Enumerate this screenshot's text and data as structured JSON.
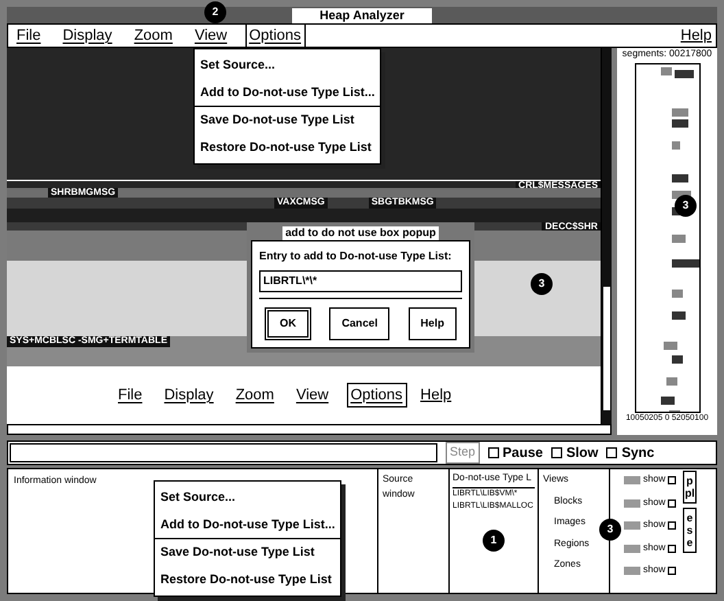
{
  "window": {
    "title": "Heap Analyzer",
    "callout": "2"
  },
  "menu_bar": {
    "items": [
      {
        "label": "File",
        "selected": false
      },
      {
        "label": "Display",
        "selected": false
      },
      {
        "label": "Zoom",
        "selected": false
      },
      {
        "label": "View",
        "selected": false
      },
      {
        "label": "Options",
        "selected": true
      }
    ],
    "help": "Help"
  },
  "options_menu": {
    "items": [
      {
        "label": "Set Source...",
        "separator_before": false
      },
      {
        "label": "Add to Do-not-use Type List...",
        "separator_before": false
      },
      {
        "label": "Save Do-not-use Type List",
        "separator_before": true
      },
      {
        "label": "Restore Do-not-use Type List",
        "separator_before": false
      }
    ]
  },
  "canvas": {
    "labels": [
      "CRL$MESSAGES",
      "SHRBMGMSG",
      "VAXCMSG",
      "SBGTBKMSG",
      "DECC$SHR",
      "SYS+MCBLSC -SMG+TERMTABLE"
    ],
    "callout": "3"
  },
  "dialog": {
    "title": "add to do not use box popup",
    "prompt": "Entry to add to Do-not-use Type List:",
    "value": "LIBRTL\\*\\*",
    "buttons": [
      {
        "label": "OK",
        "default": true
      },
      {
        "label": "Cancel",
        "default": false
      },
      {
        "label": "Help",
        "default": false
      }
    ]
  },
  "canvas_menu": {
    "items": [
      {
        "label": "File",
        "selected": false
      },
      {
        "label": "Display",
        "selected": false
      },
      {
        "label": "Zoom",
        "selected": false
      },
      {
        "label": "View",
        "selected": false
      },
      {
        "label": "Options",
        "selected": true
      }
    ],
    "help": "Help"
  },
  "segments": {
    "title": "segments: 00217800",
    "axis": "10050205 0 52050100",
    "callout": "3"
  },
  "controls": {
    "step": {
      "label": "Step",
      "disabled": true
    },
    "checkboxes": [
      {
        "label": "Pause",
        "checked": false
      },
      {
        "label": "Slow",
        "checked": false
      },
      {
        "label": "Sync",
        "checked": false
      }
    ]
  },
  "info_window": {
    "title": "Information window",
    "menu": [
      {
        "label": "Set Source...",
        "separator_before": false
      },
      {
        "label": "Add to Do-not-use Type List...",
        "separator_before": false
      },
      {
        "label": "Save Do-not-use Type List",
        "separator_before": true
      },
      {
        "label": "Restore Do-not-use Type List",
        "separator_before": false
      }
    ]
  },
  "source_window": {
    "title": "Source window"
  },
  "type_list": {
    "title": "Do-not-use Type L",
    "items": [
      "LIBRTL\\LIB$VM\\*",
      "LIBRTL\\LIB$MALLOC"
    ],
    "callout": "1"
  },
  "views": {
    "title": "Views",
    "items": [
      "Blocks",
      "Images",
      "Regions",
      "Zones"
    ],
    "callout": "3"
  },
  "show_panel": {
    "rows": [
      {
        "label": "show",
        "checked": false
      },
      {
        "label": "show",
        "checked": false
      },
      {
        "label": "show",
        "checked": false
      },
      {
        "label": "show",
        "checked": false
      },
      {
        "label": "show",
        "checked": false
      }
    ]
  },
  "side_buttons": [
    "ppl",
    "ese"
  ]
}
